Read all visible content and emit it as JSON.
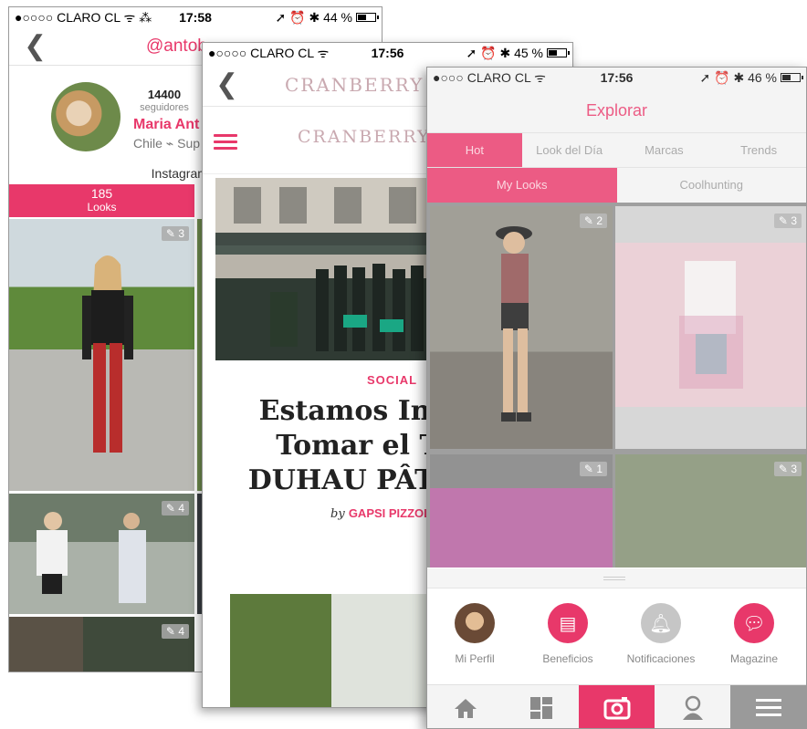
{
  "colors": {
    "accent": "#e8386a",
    "muted": "#c9a9b0",
    "gray": "#9a9a9a"
  },
  "phone1": {
    "status": {
      "carrier": "●○○○○ CLARO CL ᯤ ⁂",
      "time": "17:58",
      "right": "➚ ⏰ ✱ 44 %",
      "battery_level": 0.44
    },
    "nav": {
      "back_icon": "chevron-left",
      "handle": "@antob"
    },
    "profile": {
      "followers": "14400",
      "followers_label": "seguidores",
      "name": "Maria Ant",
      "location": "Chile ⌁ Sup",
      "instagram": "Instagram: @antoniabuln"
    },
    "looks": {
      "count": "185",
      "label": "Looks"
    },
    "tiles": [
      {
        "tag": "3"
      },
      {
        "tag": "4"
      },
      {
        "tag": "4"
      }
    ]
  },
  "phone2": {
    "status": {
      "carrier": "●○○○○ CLARO CL ᯤ",
      "time": "17:56",
      "right": "➚ ⏰ ✱ 45 %",
      "battery_level": 0.45
    },
    "nav": {
      "back_icon": "chevron-left",
      "brand": "CRANBERRY"
    },
    "bar": {
      "brand": "CRANBERRY"
    },
    "article": {
      "category": "SOCIAL",
      "title_lines": [
        "Estamos Invi",
        "Tomar el T",
        "DUHAU PÂTIS"
      ],
      "by": "by",
      "author": "GAPSI PIZZOL"
    }
  },
  "phone3": {
    "status": {
      "carrier": "●○○○ CLARO CL ᯤ",
      "time": "17:56",
      "right": "➚ ⏰ ✱ 46 %",
      "battery_level": 0.46
    },
    "title": "Explorar",
    "tabs": [
      "Hot",
      "Look del Día",
      "Marcas",
      "Trends"
    ],
    "subtabs": [
      "My Looks",
      "Coolhunting"
    ],
    "tiles": [
      {
        "tag": "2"
      },
      {
        "tag": "3"
      },
      {
        "tag": "1"
      },
      {
        "tag": "3"
      }
    ],
    "actions": [
      "Mi Perfil",
      "Beneficios",
      "Notificaciones",
      "Magazine"
    ],
    "tabbar": [
      "home-icon",
      "grid-icon",
      "camera-icon",
      "user-icon",
      "menu-icon"
    ]
  }
}
